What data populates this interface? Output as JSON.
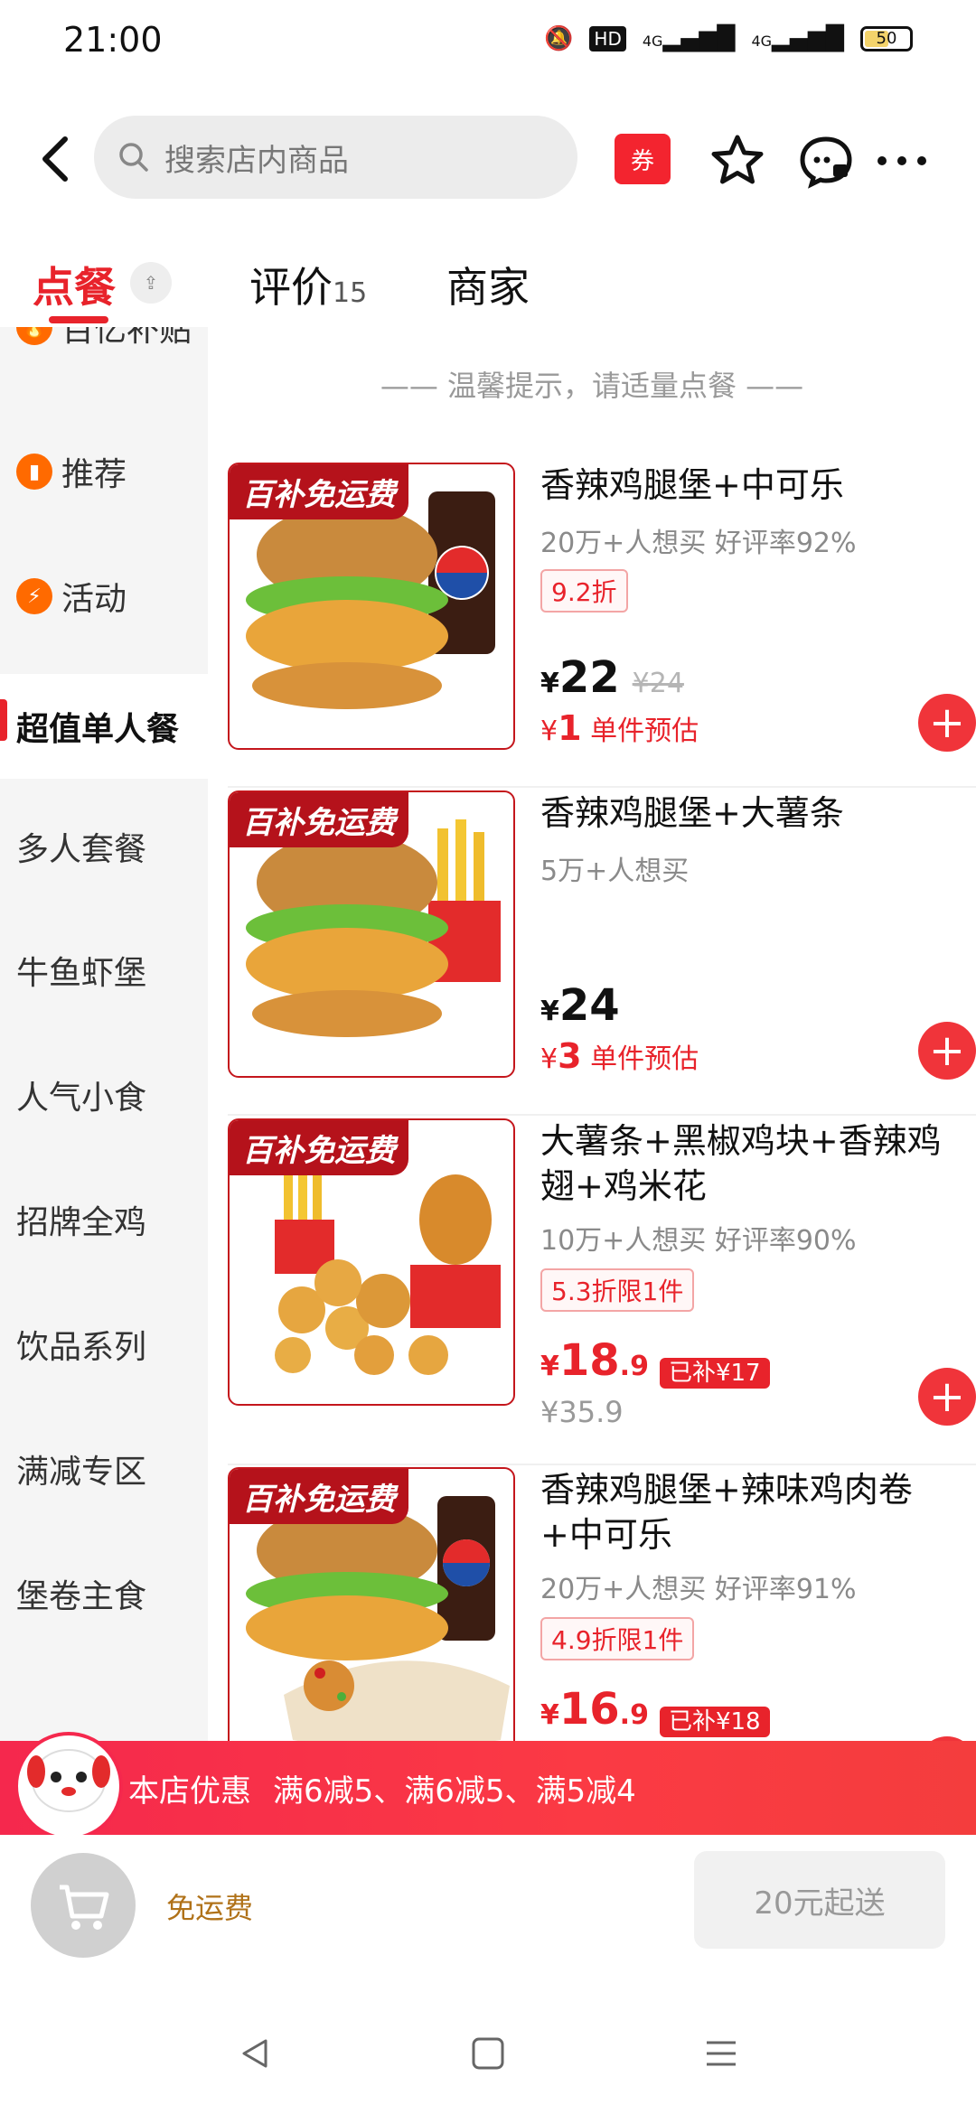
{
  "status": {
    "time": "21:00",
    "battery": "50",
    "net1": "4G",
    "net2": "4G",
    "hd": "HD"
  },
  "header": {
    "search_placeholder": "搜索店内商品",
    "coupon_label": "券"
  },
  "tabs": [
    {
      "label": "点餐",
      "active": true
    },
    {
      "label": "评价",
      "count": "15"
    },
    {
      "label": "商家"
    }
  ],
  "sidebar": {
    "items": [
      {
        "label": "百亿补贴",
        "icon": "flame-icon"
      },
      {
        "label": "推荐",
        "icon": "bookmark-icon"
      },
      {
        "label": "活动",
        "icon": "bolt-icon"
      },
      {
        "label": "超值单人餐",
        "active": true
      },
      {
        "label": "多人套餐"
      },
      {
        "label": "牛鱼虾堡"
      },
      {
        "label": "人气小食"
      },
      {
        "label": "招牌全鸡"
      },
      {
        "label": "饮品系列"
      },
      {
        "label": "满减专区"
      },
      {
        "label": "堡卷主食"
      }
    ]
  },
  "main": {
    "tip": "温馨提示，请适量点餐",
    "ribbon_label": "百补免运费",
    "products": [
      {
        "title": "香辣鸡腿堡+中可乐",
        "sub": "20万+人想买 好评率92%",
        "discount": "9.2折",
        "price_yen": "¥",
        "price_int": "22",
        "old_price": "¥24",
        "est_yen": "¥",
        "est_val": "1",
        "est_label": "单件预估"
      },
      {
        "title": "香辣鸡腿堡+大薯条",
        "sub": "5万+人想买",
        "price_yen": "¥",
        "price_int": "24",
        "est_yen": "¥",
        "est_val": "3",
        "est_label": "单件预估"
      },
      {
        "title": "大薯条+黑椒鸡块+香辣鸡翅+鸡米花",
        "sub": "10万+人想买 好评率90%",
        "discount": "5.3折限1件",
        "price_yen": "¥",
        "price_int": "18",
        "price_dec": ".9",
        "subsidy": "已补¥17",
        "orig_price": "¥35.9"
      },
      {
        "title": "香辣鸡腿堡+辣味鸡肉卷+中可乐",
        "sub": "20万+人想买 好评率91%",
        "discount": "4.9折限1件",
        "price_yen": "¥",
        "price_int": "16",
        "price_dec": ".9",
        "subsidy": "已补¥18"
      }
    ]
  },
  "promo": {
    "label": "本店优惠",
    "text": "满6减5、满6减5、满5减4"
  },
  "cart": {
    "free_shipping": "免运费",
    "min_order": "20元起送"
  },
  "colors": {
    "accent": "#e8232b",
    "promo": "#f5284d",
    "ribbon": "#b5121b"
  }
}
